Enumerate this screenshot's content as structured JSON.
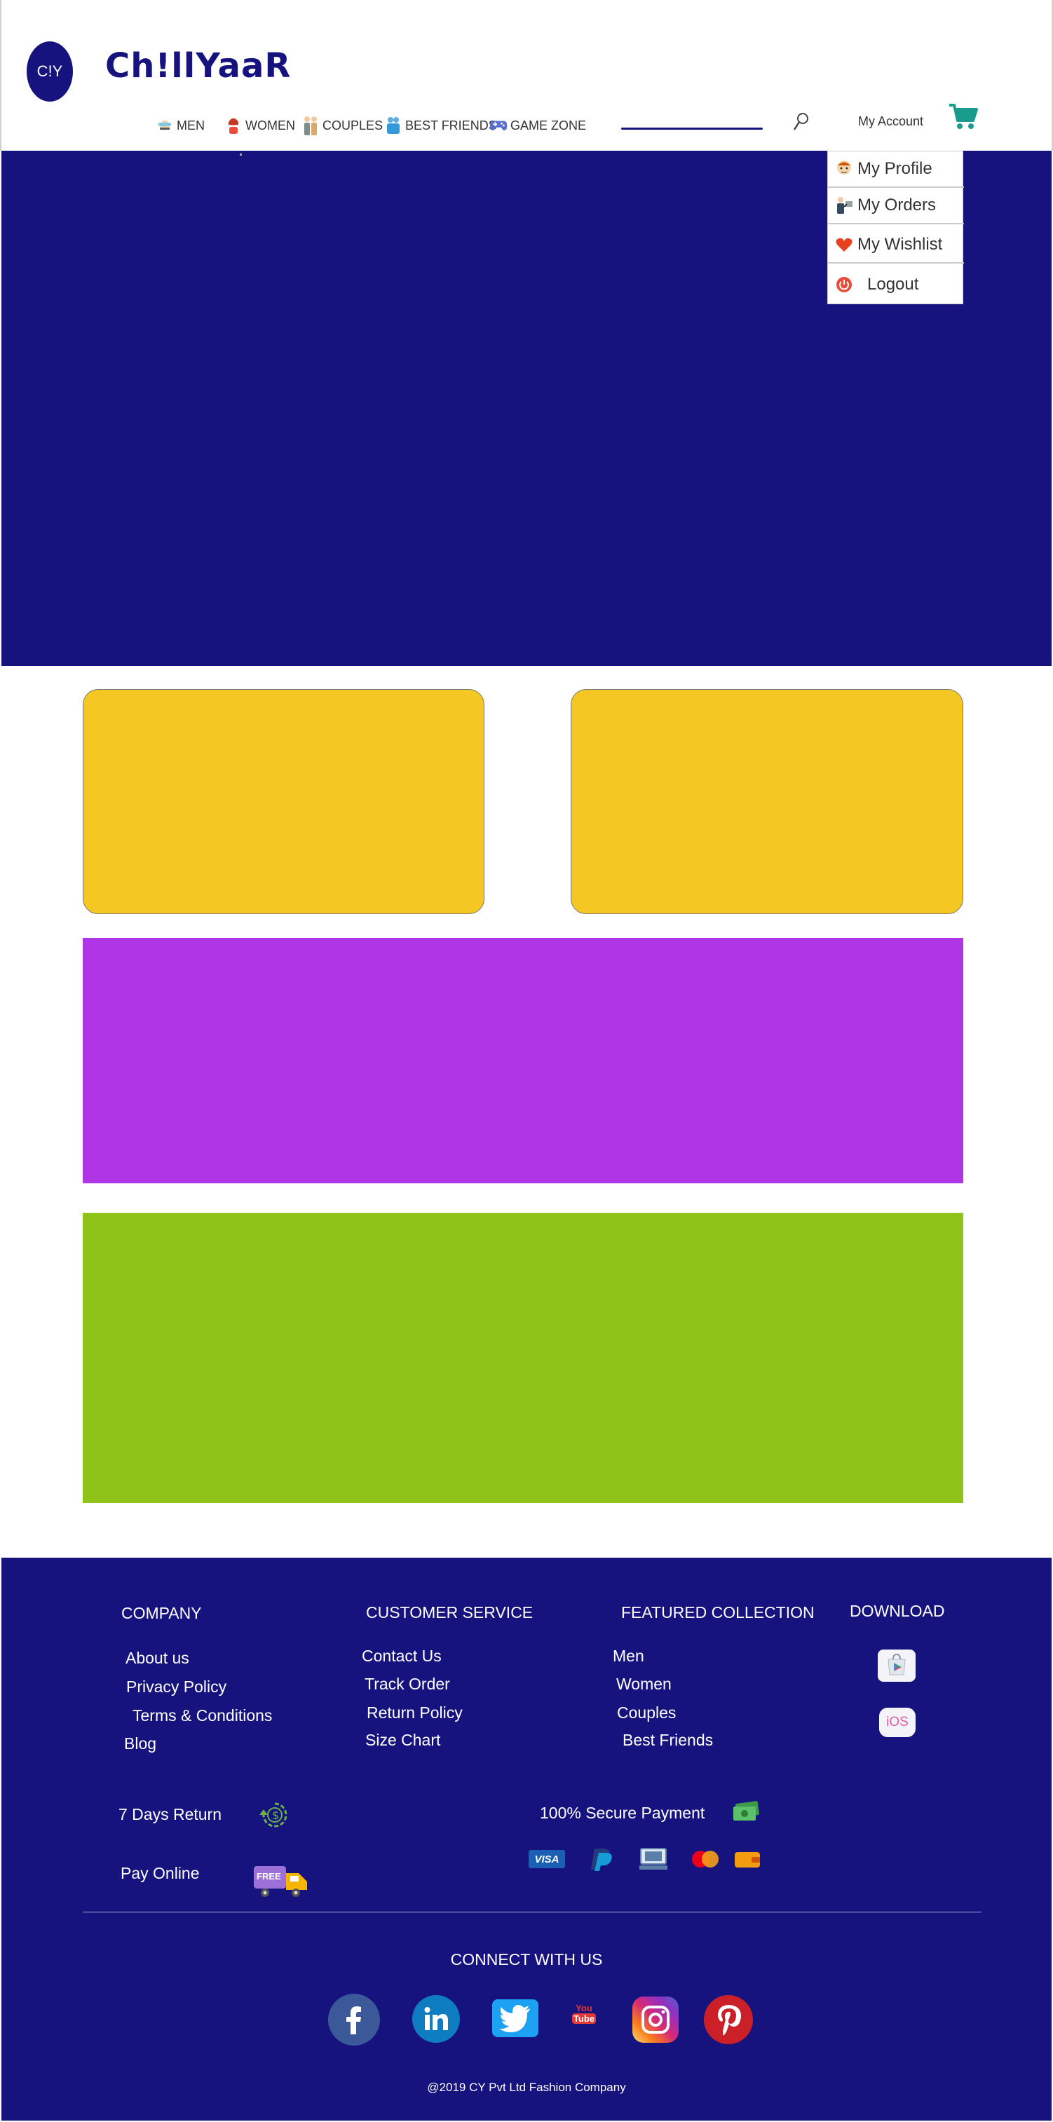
{
  "header": {
    "logo_text": "C!Y",
    "brand": "Ch!llYaaR",
    "nav": [
      {
        "label": "MEN",
        "icon": "man-icon"
      },
      {
        "label": "WOMEN",
        "icon": "woman-icon"
      },
      {
        "label": "COUPLES",
        "icon": "couple-icon"
      },
      {
        "label": "BEST FRIENDS",
        "icon": "friends-icon"
      },
      {
        "label": "GAME ZONE",
        "icon": "gamepad-icon"
      }
    ],
    "account_label": "My Account"
  },
  "dropdown": {
    "items": [
      {
        "label": "My Profile",
        "icon": "profile-icon"
      },
      {
        "label": "My Orders",
        "icon": "orders-icon"
      },
      {
        "label": "My Wishlist",
        "icon": "heart-icon"
      },
      {
        "label": "Logout",
        "icon": "power-icon"
      }
    ]
  },
  "footer": {
    "company": {
      "heading": "COMPANY",
      "links": [
        "About us",
        "Privacy Policy",
        "Terms & Conditions",
        "Blog"
      ]
    },
    "customer_service": {
      "heading": "CUSTOMER SERVICE",
      "links": [
        "Contact Us",
        "Track Order",
        "Return Policy",
        "Size Chart"
      ]
    },
    "featured": {
      "heading": "FEATURED COLLECTION",
      "links": [
        "Men",
        "Women",
        "Couples",
        "Best Friends"
      ]
    },
    "download": {
      "heading": "DOWNLOAD",
      "ios_label": "iOS"
    },
    "returns_label": "7  Days Return",
    "pay_online_label": "Pay Online",
    "free_badge": "FREE",
    "secure_payment_label": "100% Secure Payment",
    "visa_label": "VISA",
    "youtube_top": "You",
    "youtube_bottom": "Tube",
    "connect_label": "CONNECT WITH US",
    "copyright": "@2019 CY Pvt Ltd Fashion Company"
  },
  "colors": {
    "primary": "#16137f",
    "yellow": "#f5c722",
    "purple": "#b035e6",
    "green": "#8fc31a",
    "cart": "#1a9c8c"
  }
}
